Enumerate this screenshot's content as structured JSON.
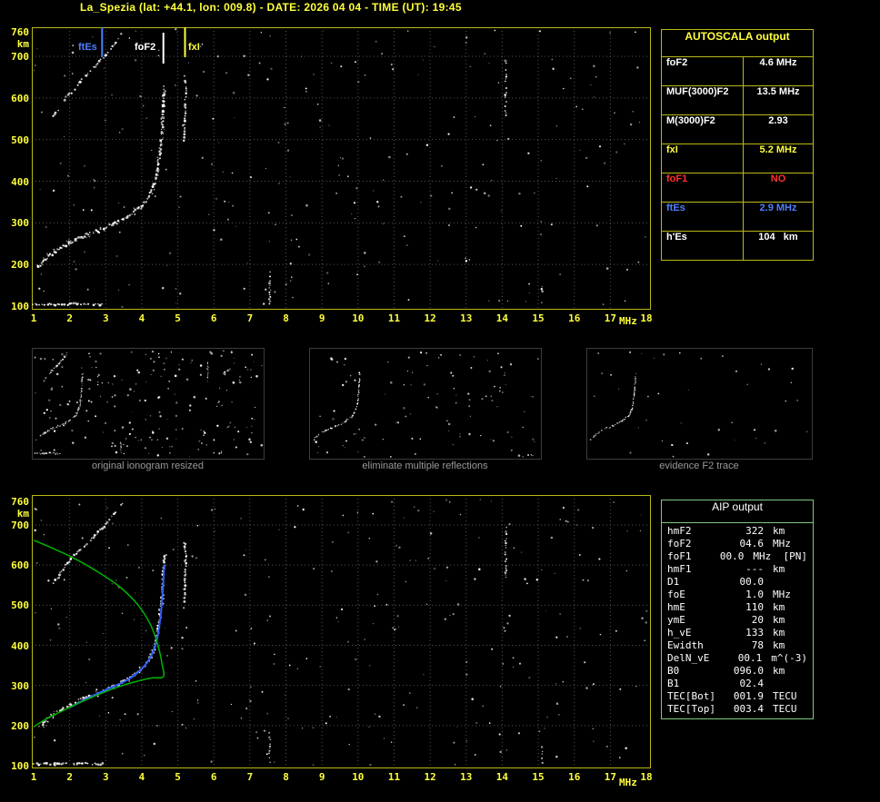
{
  "header": {
    "title": "La_Spezia (lat: +44.1, lon: 009.8) - DATE: 2026 04 04 - TIME (UT): 19:45"
  },
  "colors": {
    "background": "#000000",
    "axis_text": "#ffff3c",
    "plot_border": "#b9b918",
    "grid": "#565656",
    "trace": "#ffffff",
    "profile_green": "#00b400",
    "fitted_blue": "#2d5cff",
    "ftEs_blue": "#4f7fff",
    "fxI_yellow": "#ffff3c",
    "foF1_red": "#ff3030",
    "caption_gray": "#9a9a9a",
    "aip_border": "#7fc97f"
  },
  "main_plot": {
    "marker_labels": {
      "ftEs": "ftEs",
      "foF2": "foF2",
      "fxI": "fxI"
    }
  },
  "autoscala": {
    "title": "AUTOSCALA output",
    "rows": [
      {
        "label": "foF2",
        "value": "4.6 MHz",
        "color": "white"
      },
      {
        "label": "MUF(3000)F2",
        "value": "13.5 MHz",
        "color": "white"
      },
      {
        "label": "M(3000)F2",
        "value": "2.93",
        "color": "white"
      },
      {
        "label": "fxI",
        "value": "5.2 MHz",
        "color": "yellow"
      },
      {
        "label": "foF1",
        "value": "NO",
        "color": "red"
      },
      {
        "label": "ftEs",
        "value": "2.9 MHz",
        "color": "blue"
      },
      {
        "label": "h'Es",
        "value": "104   km",
        "color": "white"
      }
    ]
  },
  "thumbnails": [
    {
      "caption": "original ionogram resized"
    },
    {
      "caption": "eliminate multiple reflections"
    },
    {
      "caption": "evidence F2 trace"
    }
  ],
  "aip": {
    "title": "AIP output",
    "rows": [
      {
        "label": "hmF2",
        "value": "322",
        "unit": "km"
      },
      {
        "label": "foF2",
        "value": "04.6",
        "unit": "MHz"
      },
      {
        "label": "foF1",
        "value": "00.0",
        "unit": "MHz  [PN]"
      },
      {
        "label": "hmF1",
        "value": "---",
        "unit": "km"
      },
      {
        "label": "D1",
        "value": "00.0",
        "unit": ""
      },
      {
        "label": "foE",
        "value": "1.0",
        "unit": "MHz"
      },
      {
        "label": "hmE",
        "value": "110",
        "unit": "km"
      },
      {
        "label": "ymE",
        "value": "20",
        "unit": "km"
      },
      {
        "label": "h_vE",
        "value": "133",
        "unit": "km"
      },
      {
        "label": "Ewidth",
        "value": "78",
        "unit": "km"
      },
      {
        "label": "DelN_vE",
        "value": "00.1",
        "unit": "m^(-3)"
      },
      {
        "label": "B0",
        "value": "096.0",
        "unit": "km"
      },
      {
        "label": "B1",
        "value": "02.4",
        "unit": ""
      },
      {
        "label": "TEC[Bot]",
        "value": "001.9",
        "unit": "TECU"
      },
      {
        "label": "TEC[Top]",
        "value": "003.4",
        "unit": "TECU"
      }
    ]
  },
  "chart_data": {
    "type": "scatter",
    "title": "La_Spezia ionogram 2026 04 04 19:45 UT with AUTOSCALA interpretation",
    "xlabel": "MHz",
    "ylabel": "km",
    "xlim": [
      1,
      18
    ],
    "ylim": [
      100,
      760
    ],
    "x_ticks": [
      1,
      2,
      3,
      4,
      5,
      6,
      7,
      8,
      9,
      10,
      11,
      12,
      13,
      14,
      15,
      16,
      17,
      18
    ],
    "y_ticks": [
      760,
      700,
      600,
      500,
      400,
      300,
      200,
      100
    ],
    "grid": "dotted",
    "markers": {
      "ftEs_MHz": 2.9,
      "foF2_MHz": 4.6,
      "fxI_MHz": 5.2,
      "hEs_km": 104
    },
    "traces": {
      "f2_echo": [
        [
          1.15,
          195
        ],
        [
          1.5,
          225
        ],
        [
          2.0,
          252
        ],
        [
          2.4,
          268
        ],
        [
          2.8,
          282
        ],
        [
          3.2,
          296
        ],
        [
          3.6,
          315
        ],
        [
          4.0,
          340
        ],
        [
          4.2,
          362
        ],
        [
          4.35,
          392
        ],
        [
          4.45,
          432
        ],
        [
          4.52,
          482
        ],
        [
          4.57,
          532
        ],
        [
          4.6,
          582
        ],
        [
          4.63,
          625
        ]
      ],
      "f2_second_hop": [
        [
          1.55,
          555
        ],
        [
          1.9,
          600
        ],
        [
          2.3,
          640
        ],
        [
          2.7,
          675
        ],
        [
          3.0,
          702
        ],
        [
          3.25,
          730
        ],
        [
          3.45,
          755
        ]
      ],
      "es_layer": [
        [
          1.0,
          104
        ],
        [
          1.6,
          104
        ],
        [
          2.2,
          105
        ],
        [
          2.9,
          104
        ]
      ],
      "x_mode": [
        [
          5.18,
          495
        ],
        [
          5.2,
          560
        ],
        [
          5.22,
          620
        ],
        [
          5.2,
          655
        ]
      ],
      "profile": [
        [
          1.0,
          197
        ],
        [
          1.4,
          219
        ],
        [
          1.9,
          241
        ],
        [
          2.4,
          262
        ],
        [
          2.9,
          281
        ],
        [
          3.4,
          298
        ],
        [
          3.9,
          311
        ],
        [
          4.3,
          319
        ],
        [
          4.6,
          322
        ],
        [
          4.56,
          355
        ],
        [
          4.45,
          400
        ],
        [
          4.25,
          450
        ],
        [
          3.9,
          500
        ],
        [
          3.4,
          545
        ],
        [
          2.8,
          582
        ],
        [
          2.1,
          618
        ],
        [
          1.5,
          643
        ],
        [
          1.0,
          662
        ]
      ],
      "fitted": [
        [
          2.0,
          245
        ],
        [
          2.5,
          268
        ],
        [
          3.0,
          289
        ],
        [
          3.5,
          309
        ],
        [
          3.9,
          333
        ],
        [
          4.2,
          364
        ],
        [
          4.4,
          407
        ],
        [
          4.5,
          457
        ],
        [
          4.56,
          507
        ],
        [
          4.6,
          557
        ],
        [
          4.62,
          600
        ]
      ]
    },
    "rfi_streaks": [
      {
        "MHz": 7.55,
        "km": [
          103,
          182
        ]
      },
      {
        "MHz": 14.1,
        "km": [
          555,
          700
        ]
      },
      {
        "MHz": 15.1,
        "km": [
          103,
          152
        ]
      }
    ]
  }
}
